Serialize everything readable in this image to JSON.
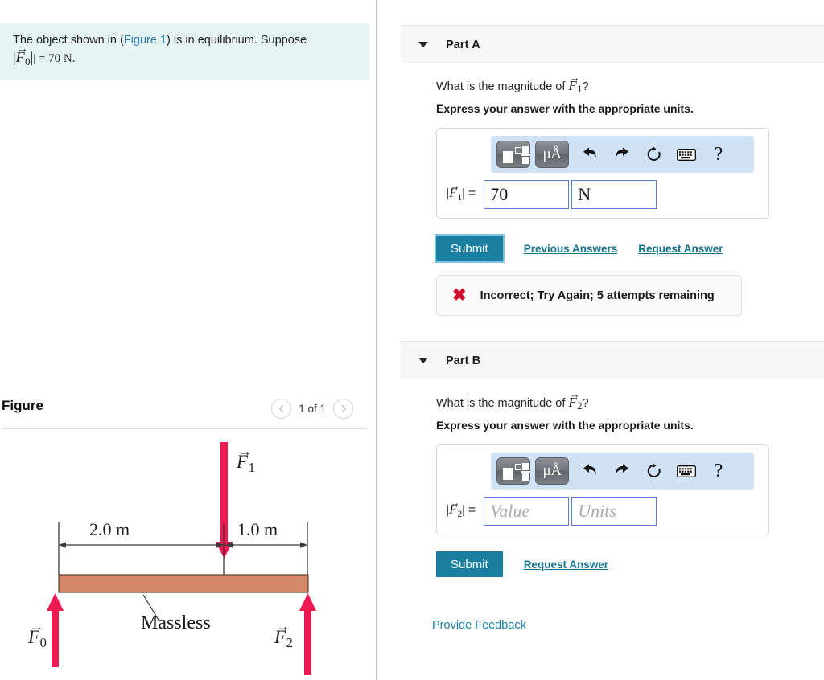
{
  "problem": {
    "line1_pre": "The object shown in (",
    "line1_link": "Figure 1",
    "line1_post": ") is in equilibrium. Suppose",
    "line2_equals": "| = 70 N."
  },
  "figure": {
    "title": "Figure",
    "pager_label": "1 of 1",
    "prev_icon": "chevron-left-icon",
    "next_icon": "chevron-right-icon",
    "diagram": {
      "left_span_label": "2.0 m",
      "right_span_label": "1.0 m",
      "beam_label": "Massless",
      "force_down_label": "F",
      "force_down_sub": "1",
      "force_left_label": "F",
      "force_left_sub": "0",
      "force_right_label": "F",
      "force_right_sub": "2",
      "beam_color": "#d4886a",
      "arrow_color": "#ec1b52"
    }
  },
  "parts": [
    {
      "id": "part-a",
      "title": "Part A",
      "caret_icon": "caret-down-icon",
      "question_pre": "What is the magnitude of ",
      "question_sub": "1",
      "question_post": "?",
      "express": "Express your answer with the appropriate units.",
      "lhs_sub": "1",
      "value": "70",
      "units": "N",
      "value_placeholder": "Value",
      "units_placeholder": "Units",
      "submit_label": "Submit",
      "links": [
        "Previous Answers",
        "Request Answer"
      ],
      "feedback": {
        "icon": "x-mark-icon",
        "text": "Incorrect; Try Again; 5 attempts remaining"
      }
    },
    {
      "id": "part-b",
      "title": "Part B",
      "caret_icon": "caret-down-icon",
      "question_pre": "What is the magnitude of ",
      "question_sub": "2",
      "question_post": "?",
      "express": "Express your answer with the appropriate units.",
      "lhs_sub": "2",
      "value": "",
      "units": "",
      "value_placeholder": "Value",
      "units_placeholder": "Units",
      "submit_label": "Submit",
      "links": [
        "Request Answer"
      ]
    }
  ],
  "toolbar": {
    "template_icon": "math-template-icon",
    "units_icon": "micro-angstrom-units-icon",
    "units_label_mu": "μ",
    "units_label_a": "Å",
    "undo_icon": "undo-arrow-icon",
    "redo_icon": "redo-arrow-icon",
    "reset_icon": "reset-circle-icon",
    "keyboard_icon": "keyboard-icon",
    "help_icon": "question-mark-icon",
    "help_label": "?"
  },
  "footer": {
    "provide_feedback": "Provide Feedback"
  },
  "colors": {
    "accent": "#1a7fa0",
    "link": "#16738f",
    "error": "#cf0a2c",
    "statement_bg": "#e6f4f4",
    "toolbar_bg": "#cfe2f6",
    "beam": "#d4886a",
    "arrow": "#ec1b52"
  }
}
